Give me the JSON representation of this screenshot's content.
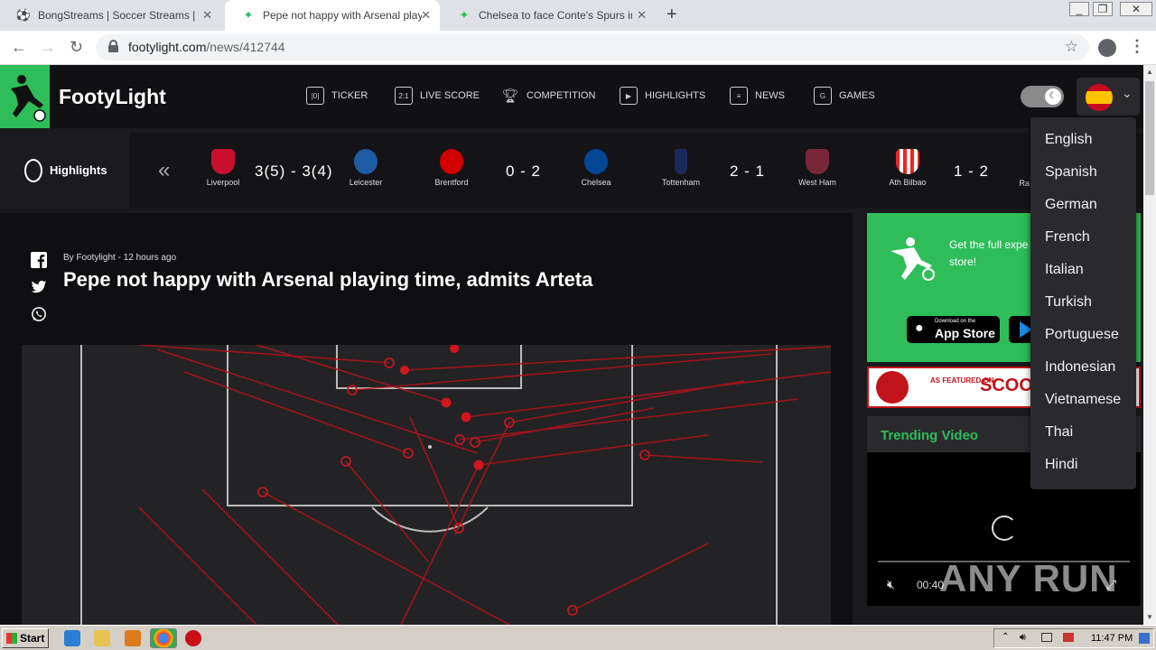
{
  "browser": {
    "tabs": [
      {
        "title": "BongStreams | Soccer Streams | NBA",
        "active": false
      },
      {
        "title": "Pepe not happy with Arsenal playing",
        "active": true
      },
      {
        "title": "Chelsea to face Conte's Spurs in EFL",
        "active": false
      }
    ],
    "url_host": "footylight.com",
    "url_path": "/news/412744"
  },
  "site": {
    "name": "FootyLight",
    "nav": [
      "TICKER",
      "LIVE SCORE",
      "COMPETITION",
      "HIGHLIGHTS",
      "NEWS",
      "GAMES"
    ],
    "nav_icons": [
      "ticker-icon",
      "live-score-icon",
      "trophy-icon",
      "play-icon",
      "news-icon",
      "games-icon"
    ],
    "brand_color": "#2ebd59"
  },
  "highlights": {
    "label": "Highlights",
    "matches": [
      {
        "home": "Liverpool",
        "score": "3(5) - 3(4)",
        "away": "Leicester",
        "home_color": "#c8102e",
        "away_color": "#1d5ba4"
      },
      {
        "home": "Brentford",
        "score": "0 - 2",
        "away": "Chelsea",
        "home_color": "#d20000",
        "away_color": "#034694"
      },
      {
        "home": "Tottenham",
        "score": "2 - 1",
        "away": "West Ham",
        "home_color": "#1a2a5a",
        "away_color": "#7a263a"
      },
      {
        "home": "Ath Bilbao",
        "score": "1 - 2",
        "away": "Ra",
        "home_color": "#ee2523",
        "away_color": "#cccccc"
      }
    ]
  },
  "article": {
    "byline": "By Footylight - 12 hours ago",
    "headline": "Pepe not happy with Arsenal playing time, admits Arteta"
  },
  "sidebar": {
    "promo_text": "Get the full expe Football, Downl store!",
    "app_store_small": "Download on the",
    "app_store_big": "App Store",
    "banner_small": "AS FEATURED ON",
    "banner_big": "SCOO",
    "trending_title": "Trending Video",
    "video_time": "00:40"
  },
  "languages": [
    "English",
    "Spanish",
    "German",
    "French",
    "Italian",
    "Turkish",
    "Portuguese",
    "Indonesian",
    "Vietnamese",
    "Thai",
    "Hindi"
  ],
  "watermark": "ANY RUN",
  "taskbar": {
    "start": "Start",
    "clock": "11:47 PM"
  }
}
